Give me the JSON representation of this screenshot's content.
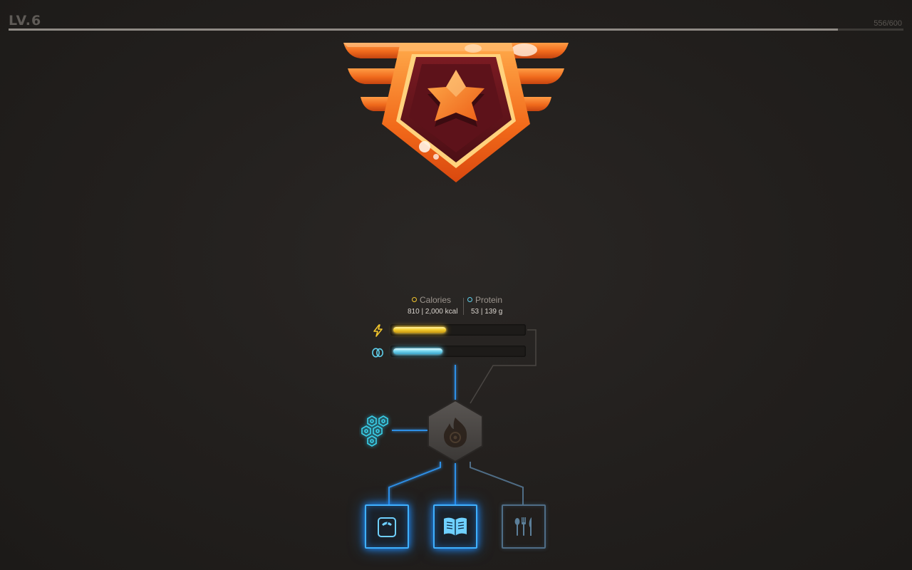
{
  "player": {
    "level": "LV.6",
    "xp_text": "556/600",
    "xp_current": 556,
    "xp_max": 600
  },
  "emblem": {
    "icon": "star-shield-wings-icon"
  },
  "nutrition": {
    "calories": {
      "label": "Calories",
      "value_text": "810 | 2,000 kcal",
      "current": 810,
      "goal": 2000,
      "icon": "lightning-icon",
      "color": "#f3c62d"
    },
    "protein": {
      "label": "Protein",
      "value_text": "53 | 139 g",
      "current": 53,
      "goal": 139,
      "icon": "egg-icon",
      "color": "#5fd0ec"
    }
  },
  "skill_tree": {
    "center_node_icon": "flame-icon",
    "left_node_icon": "hexagon-cluster-icon",
    "tiles": [
      {
        "icon": "scale-icon",
        "state": "active"
      },
      {
        "icon": "book-icon",
        "state": "active"
      },
      {
        "icon": "utensils-icon",
        "state": "inactive"
      }
    ]
  },
  "colors": {
    "accent_blue": "#3fb0ff",
    "gold": "#f3c62d",
    "cyan": "#5fd0ec",
    "background": "#242120"
  }
}
